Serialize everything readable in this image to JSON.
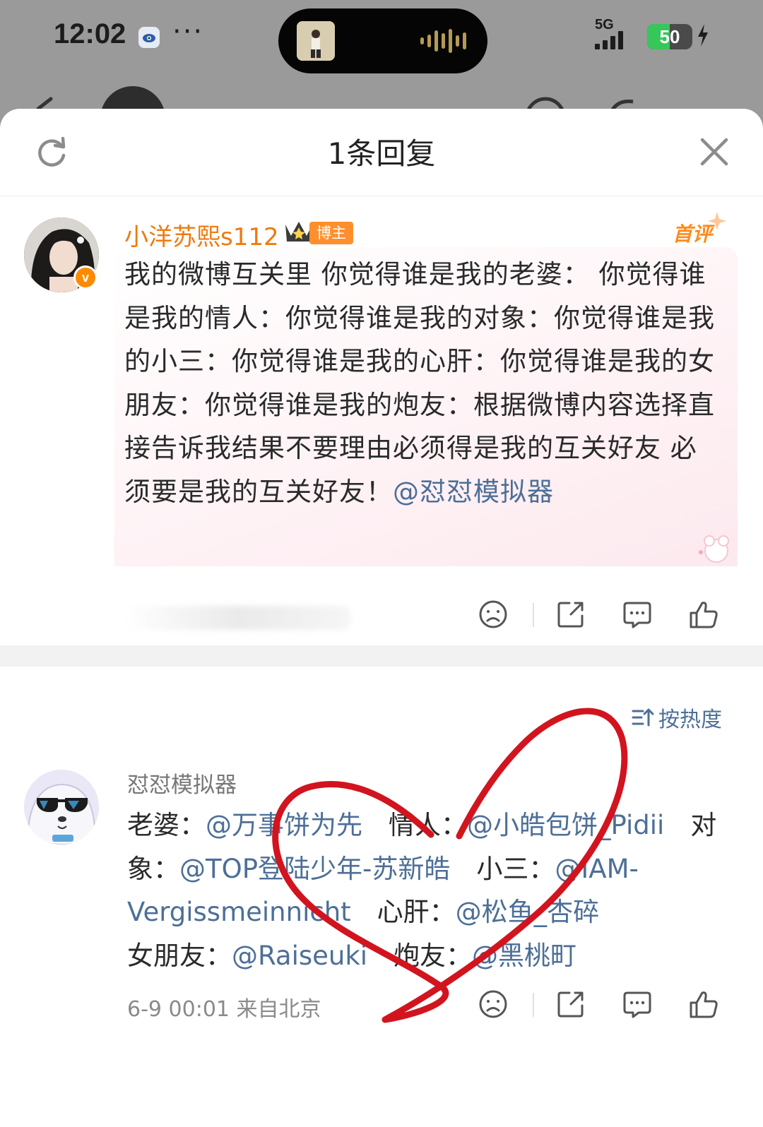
{
  "status_bar": {
    "time": "12:02",
    "network": "5G",
    "battery": "50",
    "battery_level": 0.5,
    "more": "···"
  },
  "sheet": {
    "title": "1条回复",
    "refresh_icon": "refresh-icon",
    "close_icon": "close-icon"
  },
  "main_comment": {
    "author": "小洋苏熙s112",
    "tag": "博主",
    "badge": "首评",
    "verified": "v",
    "text": "我的微博互关里 你觉得谁是我的老婆： 你觉得谁是我的情人：你觉得谁是我的对象：你觉得谁是我的小三：你觉得谁是我的心肝：你觉得谁是我的女朋友：你觉得谁是我的炮友：根据微博内容选择直接告诉我结果不要理由必须得是我的互关好友 必须要是我的互关好友！",
    "mention": "@怼怼模拟器"
  },
  "sort": {
    "label": "按热度",
    "icon": "sort-icon"
  },
  "reply": {
    "author": "怼怼模拟器",
    "lines": [
      {
        "label": "老婆：",
        "mention": "@万事饼为先"
      },
      {
        "label": "情人：",
        "mention": "@小皓包饼_Pidii"
      },
      {
        "label": "对象：",
        "mention": "@TOP登陆少年-苏新皓"
      },
      {
        "label": "小三：",
        "mention": "@IAM-Vergissmeinnicht"
      },
      {
        "label": "心肝：",
        "mention": "@松鱼_杏碎"
      },
      {
        "label": "女朋友：",
        "mention": "@Raiseuki"
      },
      {
        "label": "炮友：",
        "mention": "@黑桃町"
      }
    ],
    "meta": "6-9 00:01 来自北京"
  },
  "colors": {
    "accent_orange": "#f07a10",
    "link_blue": "#4d6f98",
    "scribble_red": "#d2141f",
    "battery_green": "#35c759"
  }
}
